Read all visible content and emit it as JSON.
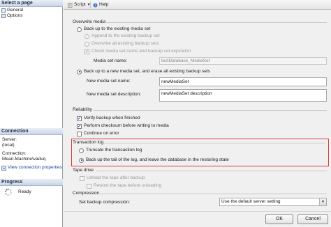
{
  "left_pane": {
    "select_page_header": "Select a page",
    "pages": [
      "General",
      "Options"
    ],
    "connection_header": "Connection",
    "server_label": "Server:",
    "server_value": "(local)",
    "connection_label": "Connection:",
    "connection_value": "Mean-Machine\\vaduq",
    "view_props_link": "View connection properties",
    "progress_header": "Progress",
    "progress_status": "Ready"
  },
  "toolbar": {
    "script_label": "Script",
    "help_label": "Help"
  },
  "overwrite_media": {
    "title": "Overwrite media",
    "backup_existing_label": "Back up to the existing media set",
    "append_label": "Append to the existing backup set",
    "overwrite_all_label": "Overwrite all existing backup sets",
    "check_expiration_label": "Check media set name and backup set expiration",
    "media_set_name_label": "Media set name:",
    "media_set_name_value": "testDatabase_MediaSet",
    "new_media_set_label": "Back up to a new media set, and erase all existing backup sets",
    "new_media_set_name_label": "New media set name:",
    "new_media_set_name_value": "newMediaSet",
    "new_media_set_desc_label": "New media set description:",
    "new_media_set_desc_value": "newMediaSet description"
  },
  "reliability": {
    "title": "Reliability",
    "verify_label": "Verify backup when finished",
    "checksum_label": "Perform checksum before writing to media",
    "continue_label": "Continue on error"
  },
  "transaction_log": {
    "title": "Transaction log",
    "truncate_label": "Truncate the transaction log",
    "tail_label": "Back up the tail of the log, and leave the database in the restoring state"
  },
  "tape_drive": {
    "title": "Tape drive",
    "unload_label": "Unload the tape after backup",
    "rewind_label": "Rewind the tape before unloading"
  },
  "compression": {
    "title": "Compression",
    "set_label": "Set backup compression:",
    "selected_value": "Use the default server setting"
  },
  "footer": {
    "ok_label": "OK",
    "cancel_label": "Cancel"
  },
  "colors": {
    "highlight_border": "#d93a3a",
    "link": "#1545a8"
  },
  "icons": [
    "page-icon",
    "script-icon",
    "help-icon",
    "progress-spinner-icon",
    "connection-icon",
    "dropdown-arrow-icon"
  ]
}
